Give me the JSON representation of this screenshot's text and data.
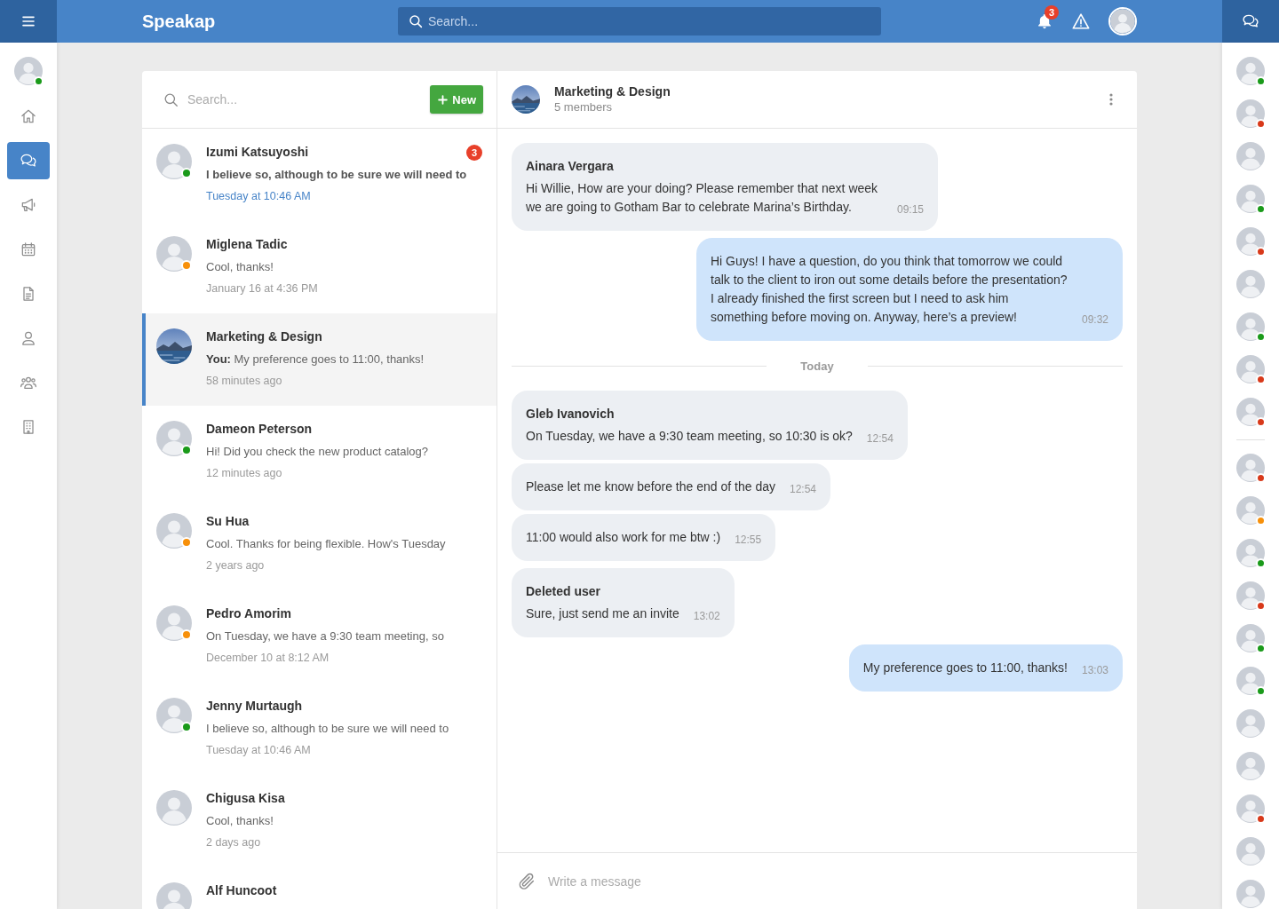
{
  "topbar": {
    "logo": "Speakap",
    "search": {
      "placeholder": "Search..."
    },
    "notification_count": "3"
  },
  "left_nav": {
    "user": {
      "color": "#1a9a1a"
    },
    "items": [
      {
        "selected": false
      },
      {
        "selected": true
      },
      {
        "selected": false
      },
      {
        "selected": false
      },
      {
        "selected": false
      },
      {
        "selected": false
      },
      {
        "selected": false
      },
      {
        "selected": false
      }
    ]
  },
  "conversation_list": {
    "search": {
      "placeholder": "Search..."
    },
    "new_button": {
      "label": "New"
    },
    "conversations": [
      {
        "kind": "person",
        "name": "Izumi Katsuyoshi",
        "message": "I believe so, although to be sure we will need to",
        "time": "Tuesday at 10:46 AM",
        "unread": true,
        "badge": "3",
        "selected": false,
        "color": "#1a9a1a"
      },
      {
        "kind": "person",
        "name": "Miglena Tadic",
        "message": "Cool, thanks!",
        "time": "January 16 at 4:36 PM",
        "unread": false,
        "selected": false,
        "color": "#f7900a"
      },
      {
        "kind": "group",
        "name": "Marketing & Design",
        "message": "**You:** My preference goes to 11:00, thanks!",
        "time": "58 minutes ago",
        "unread": false,
        "selected": true
      },
      {
        "kind": "person",
        "name": "Dameon Peterson",
        "message": "Hi! Did you check the new product catalog?",
        "time": "12 minutes ago",
        "unread": false,
        "selected": false,
        "color": "#1a9a1a"
      },
      {
        "kind": "person",
        "name": "Su Hua",
        "message": "Cool. Thanks for being flexible. How's Tuesday",
        "time": "2 years ago",
        "unread": false,
        "selected": false,
        "color": "#f7900a"
      },
      {
        "kind": "person",
        "name": "Pedro Amorim",
        "message": "On Tuesday, we have a 9:30 team meeting, so",
        "time": "December 10 at 8:12 AM",
        "unread": false,
        "selected": false,
        "color": "#f7900a"
      },
      {
        "kind": "person",
        "name": "Jenny Murtaugh",
        "message": "I believe so, although to be sure we will need to",
        "time": "Tuesday at 10:46 AM",
        "unread": false,
        "selected": false,
        "color": "#1a9a1a"
      },
      {
        "kind": "person",
        "name": "Chigusa Kisa",
        "message": "Cool, thanks!",
        "time": "2 days ago",
        "unread": false,
        "selected": false
      },
      {
        "kind": "person",
        "name": "Alf Huncoot",
        "selected": false
      }
    ]
  },
  "chat": {
    "title": "Marketing & Design",
    "subtitle": "5 members",
    "messages": [
      {
        "kind": "incoming",
        "sender": "Ainara Vergara",
        "text": "Hi Willie, How are your doing? Please remember that next week we are going to Gotham Bar to celebrate Marina’s Birthday.",
        "time": "09:15"
      },
      {
        "kind": "outgoing",
        "text": "Hi Guys! I have a question, do you think that tomorrow we could talk to the client to iron out some details before the presentation? I already finished the first screen but I need to ask him something before moving on. Anyway, here’s a preview!",
        "time": "09:32"
      },
      {
        "kind": "divider",
        "label": "Today"
      },
      {
        "kind": "incoming",
        "sender": "Gleb Ivanovich",
        "text": "On Tuesday, we have a 9:30 team meeting, so 10:30 is ok?",
        "time": "12:54"
      },
      {
        "kind": "incoming",
        "text": "Please let me know before the end of the day",
        "time": "12:54"
      },
      {
        "kind": "incoming",
        "text": "11:00 would also work for me btw :)",
        "time": "12:55"
      },
      {
        "kind": "incoming",
        "sender": "Deleted user",
        "text": "Sure, just send me an invite",
        "time": "13:02"
      },
      {
        "kind": "outgoing",
        "text": "My preference goes to 11:00, thanks!",
        "time": "13:03"
      }
    ],
    "composer": {
      "placeholder": "Write a message"
    }
  },
  "right_sidebar": {
    "groups": [
      {
        "contacts": [
          {
            "dot": true,
            "color": "#1a9a1a"
          },
          {
            "dot": true,
            "color": "#d8391a"
          },
          {
            "dot": false
          },
          {
            "dot": true,
            "color": "#1a9a1a"
          },
          {
            "dot": true,
            "color": "#d8391a"
          },
          {
            "dot": false
          },
          {
            "dot": true,
            "color": "#1a9a1a"
          },
          {
            "dot": true,
            "color": "#d8391a"
          },
          {
            "dot": true,
            "color": "#d8391a"
          }
        ]
      },
      {
        "contacts": [
          {
            "dot": true,
            "color": "#d8391a"
          },
          {
            "dot": true,
            "color": "#f7900a"
          },
          {
            "dot": true,
            "color": "#1a9a1a"
          },
          {
            "dot": true,
            "color": "#d8391a"
          },
          {
            "dot": true,
            "color": "#1a9a1a"
          },
          {
            "dot": true,
            "color": "#1a9a1a"
          },
          {
            "dot": false
          },
          {
            "dot": false
          },
          {
            "dot": true,
            "color": "#d8391a"
          },
          {
            "dot": false
          },
          {
            "dot": false
          }
        ]
      }
    ]
  }
}
